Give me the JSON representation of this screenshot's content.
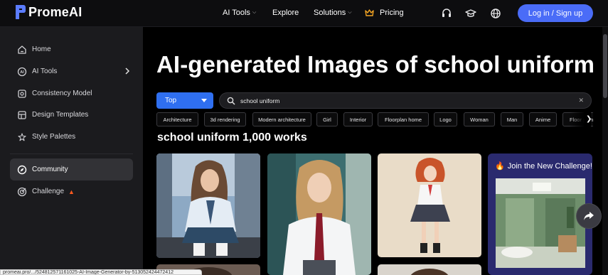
{
  "brand": {
    "name": "PromeAI"
  },
  "nav": {
    "ai_tools": "AI Tools",
    "explore": "Explore",
    "solutions": "Solutions",
    "pricing": "Pricing",
    "login": "Log in / Sign up"
  },
  "sidebar": {
    "items": [
      {
        "label": "Home",
        "icon": "home-icon"
      },
      {
        "label": "AI Tools",
        "icon": "ai-tools-icon"
      },
      {
        "label": "Consistency Model",
        "icon": "consistency-icon"
      },
      {
        "label": "Design Templates",
        "icon": "templates-icon"
      },
      {
        "label": "Style Palettes",
        "icon": "palette-icon"
      },
      {
        "label": "Community",
        "icon": "compass-icon"
      },
      {
        "label": "Challenge",
        "icon": "target-icon"
      }
    ]
  },
  "main": {
    "title": "AI-generated Images of school uniform",
    "sort_value": "Top",
    "search_value": "school uniform",
    "count_title": "school uniform 1,000 works",
    "tags": [
      "Architecture",
      "3d rendering",
      "Modern architecture",
      "Girl",
      "Interior",
      "Floorplan home",
      "Logo",
      "Woman",
      "Man",
      "Anime",
      "Floor plan"
    ],
    "challenge_title": "Join the New Challenge!"
  },
  "status_url": "promeai.pro/.../524812571161025-AI-Image-Generator-by-513052424472412",
  "colors": {
    "accent": "#4a6cf7",
    "sort_blue": "#2f6ff0",
    "sidebar_bg": "#1b1b1e",
    "challenge_bg": "#2a2a6e",
    "flame": "#ff5a1f"
  }
}
